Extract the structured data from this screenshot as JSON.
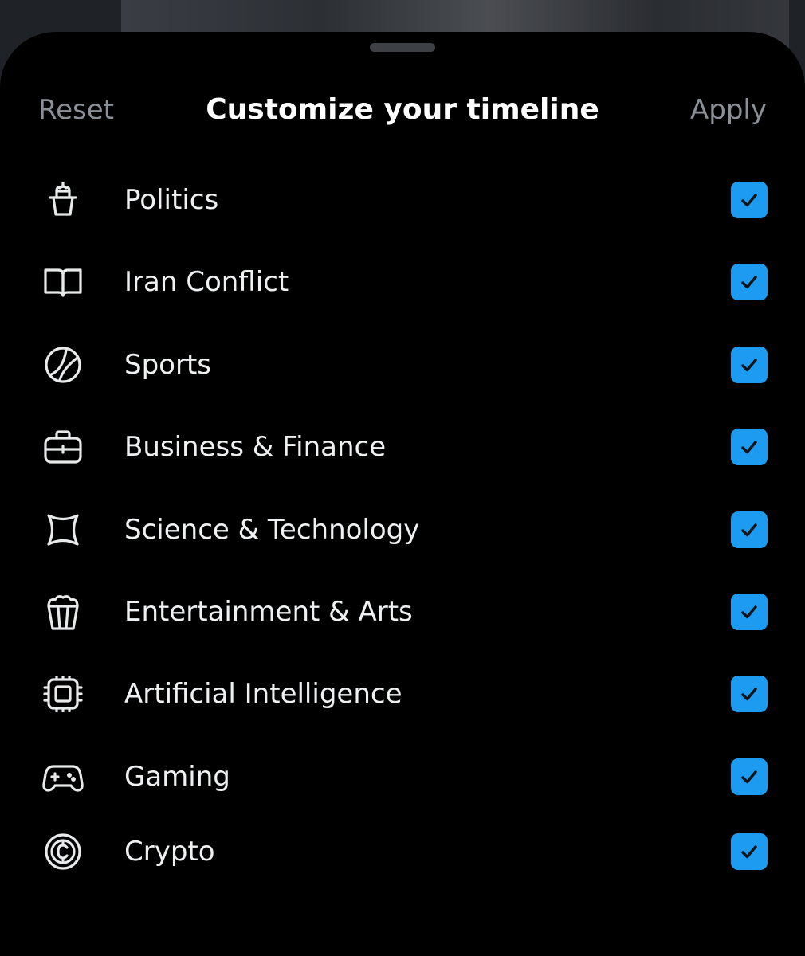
{
  "header": {
    "reset_label": "Reset",
    "title": "Customize your timeline",
    "apply_label": "Apply"
  },
  "colors": {
    "accent": "#1d9bf0",
    "sheet_background": "#000000",
    "muted_text": "#8b9096",
    "primary_text": "#eef0f2"
  },
  "topics": [
    {
      "label": "Politics",
      "icon": "capitol-icon",
      "checked": true
    },
    {
      "label": "Iran Conflict",
      "icon": "book-icon",
      "checked": true
    },
    {
      "label": "Sports",
      "icon": "ball-icon",
      "checked": true
    },
    {
      "label": "Business & Finance",
      "icon": "briefcase-icon",
      "checked": true
    },
    {
      "label": "Science & Technology",
      "icon": "atom-icon",
      "checked": true
    },
    {
      "label": "Entertainment & Arts",
      "icon": "popcorn-icon",
      "checked": true
    },
    {
      "label": "Artificial Intelligence",
      "icon": "chip-icon",
      "checked": true
    },
    {
      "label": "Gaming",
      "icon": "gamepad-icon",
      "checked": true
    },
    {
      "label": "Crypto",
      "icon": "coin-icon",
      "checked": true
    }
  ]
}
